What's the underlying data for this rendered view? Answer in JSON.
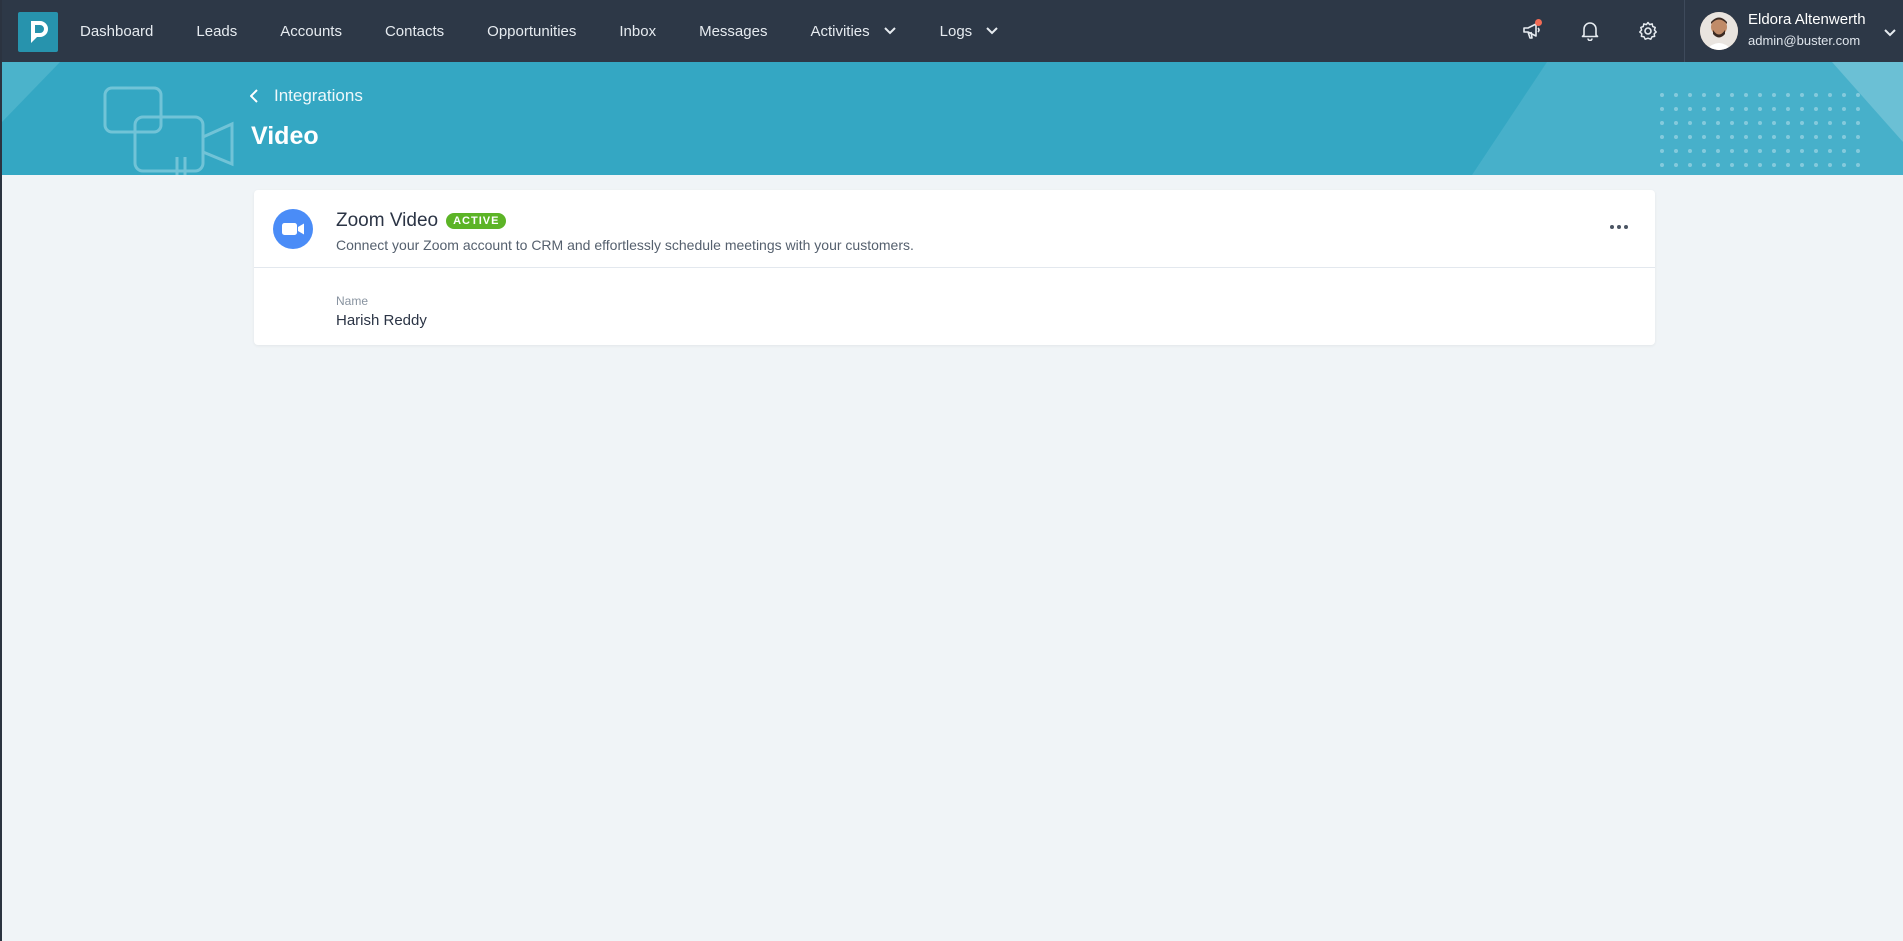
{
  "nav": {
    "items": [
      {
        "label": "Dashboard"
      },
      {
        "label": "Leads"
      },
      {
        "label": "Accounts"
      },
      {
        "label": "Contacts"
      },
      {
        "label": "Opportunities"
      },
      {
        "label": "Inbox"
      },
      {
        "label": "Messages"
      },
      {
        "label": "Activities",
        "icon": "chevron-down-icon"
      },
      {
        "label": "Logs",
        "icon": "chevron-down-icon"
      }
    ],
    "logo_icon": "app-logo",
    "icons": [
      "megaphone-icon",
      "bell-icon",
      "gear-icon"
    ]
  },
  "user": {
    "name": "Eldora Altenwerth",
    "email": "admin@buster.com"
  },
  "banner": {
    "back_label": "Integrations",
    "title": "Video"
  },
  "integration": {
    "name": "Zoom Video",
    "status": "ACTIVE",
    "description": "Connect your Zoom account to CRM and effortlessly schedule meetings with your customers.",
    "field_label": "Name",
    "field_value": "Harish Reddy",
    "icon": "video-camera-icon"
  },
  "colors": {
    "nav_bg": "#2d3847",
    "banner_bg": "#34a7c3",
    "badge_active": "#5cb426",
    "zoom_blue": "#4a8cf7",
    "notification_dot": "#f26b55"
  }
}
